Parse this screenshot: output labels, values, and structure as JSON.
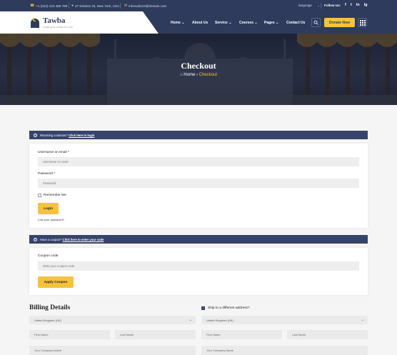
{
  "topbar": {
    "phone": "+1 (044) 123 456 789",
    "address": "27 Division St, New York, USA",
    "email": "infomail123@domain.com",
    "language": "language",
    "follow_us": "Follow Us:",
    "social": [
      "f",
      "t",
      "in",
      "ig"
    ]
  },
  "header": {
    "logo_name": "Tawba",
    "logo_tagline": "COMPLETE CODE OF LIFE",
    "nav": [
      "Home",
      "About Us",
      "Service",
      "Courses",
      "Pages",
      "Contact Us"
    ],
    "donate_label": "Donate Now"
  },
  "banner": {
    "title": "Checkout",
    "breadcrumb_home": "Home",
    "breadcrumb_current": "Checkout"
  },
  "login_notice": {
    "text": "Returning customer?",
    "link": "Click here to login"
  },
  "login_form": {
    "username_label": "Username or email *",
    "username_placeholder": "Username or email",
    "password_label": "Password *",
    "password_placeholder": "Password",
    "remember_label": "Remember Me",
    "login_button": "Login",
    "lost_password": "Lost your password?"
  },
  "coupon_notice": {
    "text": "Have a coupon?",
    "link": "Click here to enter your code"
  },
  "coupon_form": {
    "label": "Coupon code",
    "placeholder": "Write your coupon code",
    "button": "Apply Coupon"
  },
  "billing": {
    "title": "Billing Details",
    "ship_label": "Ship to a different address?",
    "country_left": "United Kingdom (UK)",
    "country_right": "United Kingdom (UK)",
    "first_name": "First Name",
    "last_name": "Last Name",
    "company": "Your Company Name"
  },
  "colors": {
    "navy": "#2e3b5c",
    "accent": "#f5c33b"
  }
}
